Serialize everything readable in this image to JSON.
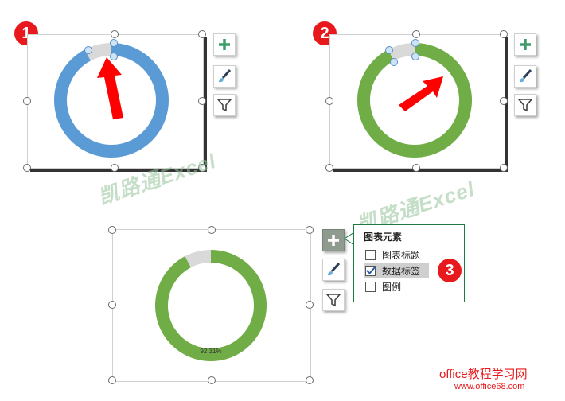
{
  "steps": [
    "1",
    "2",
    "3"
  ],
  "watermark": "凯路通Excel",
  "chart_elements_menu": {
    "title": "图表元素",
    "options": [
      {
        "label": "图表标题",
        "checked": false
      },
      {
        "label": "数据标签",
        "checked": true
      },
      {
        "label": "图例",
        "checked": false
      }
    ]
  },
  "bottom_chart": {
    "data_label": "92.31%"
  },
  "toolbar_icons": [
    "plus-icon",
    "brush-icon",
    "filter-icon"
  ],
  "site": {
    "name": "office教程学习网",
    "url": "www.office68.com"
  },
  "colors": {
    "blue_ring": "#5b9bd5",
    "green_ring": "#70ad47",
    "gray_slice": "#d9d9d9",
    "step_red": "#e8191c",
    "arrow_red": "#ff0000"
  },
  "chart_data": [
    {
      "type": "pie",
      "variant": "doughnut",
      "values": [
        92.31,
        7.69
      ],
      "colors": [
        "#5b9bd5",
        "#d9d9d9"
      ]
    },
    {
      "type": "pie",
      "variant": "doughnut",
      "values": [
        92.31,
        7.69
      ],
      "colors": [
        "#70ad47",
        "#d9d9d9"
      ]
    },
    {
      "type": "pie",
      "variant": "doughnut",
      "values": [
        92.31,
        7.69
      ],
      "colors": [
        "#70ad47",
        "#d9d9d9"
      ],
      "data_labels": [
        "92.31%"
      ]
    }
  ]
}
